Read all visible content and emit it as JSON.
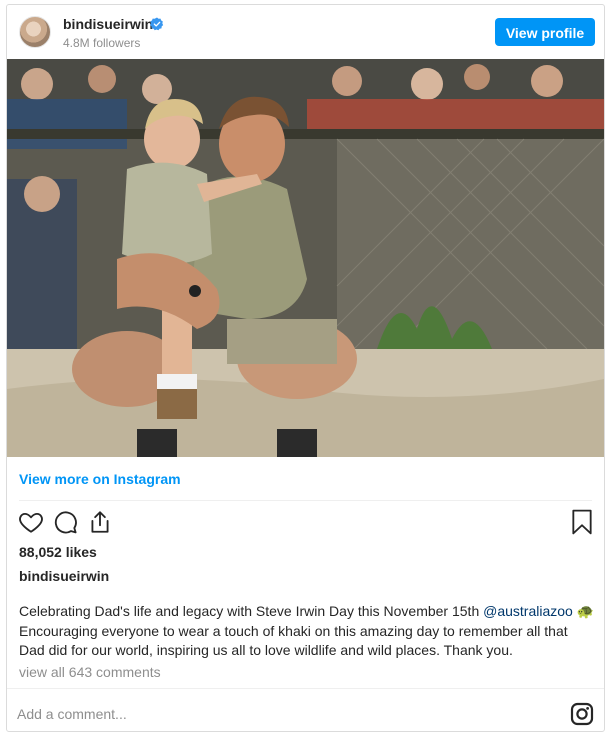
{
  "header": {
    "username": "bindisueirwin",
    "followers": "4.8M followers",
    "view_profile_label": "View profile",
    "verified_icon": "verified-badge-icon"
  },
  "post": {
    "image_alt": "Photo of a man in khaki crouching and holding a toddler at a zoo enclosure, crowd in background",
    "view_more_label": "View more on Instagram",
    "likes": "88,052 likes",
    "caption_username": "bindisueirwin",
    "caption_text": "Celebrating Dad's life and legacy with Steve Irwin Day this November 15th",
    "caption_mention": "@australiazoo",
    "caption_emoji": "🐢",
    "caption_text_2": "Encouraging everyone to wear a touch of khaki on this amazing day to remember all that Dad did for our world, inspiring us all to love wildlife and wild places. Thank you.",
    "view_comments_label": "view all 643 comments"
  },
  "actions": {
    "icons": [
      "heart-icon",
      "comment-icon",
      "share-icon",
      "bookmark-icon"
    ]
  },
  "comment_box": {
    "placeholder": "Add a comment..."
  },
  "colors": {
    "accent": "#0095f6",
    "mention": "#00376b",
    "muted": "#8e8e8e",
    "border": "#dbdbdb"
  }
}
